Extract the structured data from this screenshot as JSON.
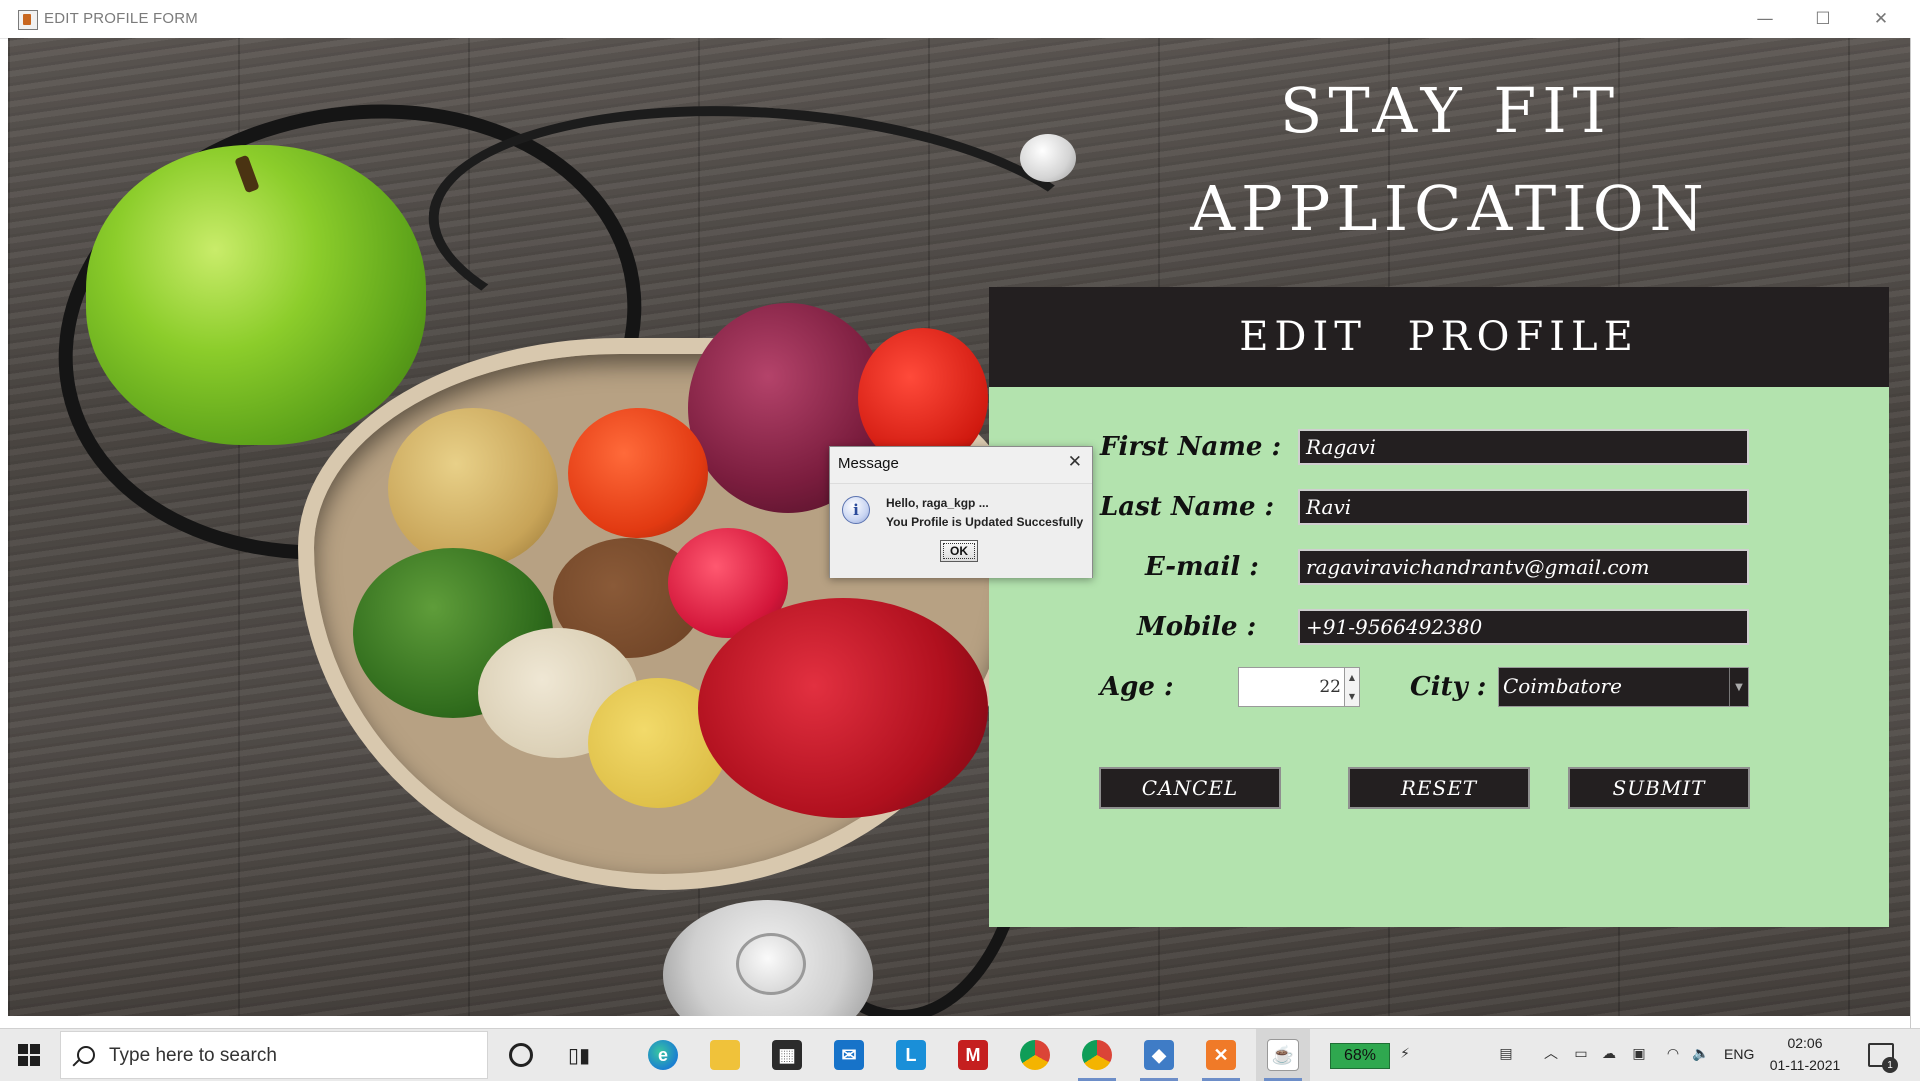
{
  "window": {
    "title": "EDIT PROFILE FORM",
    "controls": {
      "minimize": "—",
      "maximize": "☐",
      "close": "✕"
    }
  },
  "app": {
    "title_line1": "STAY FIT",
    "title_line2": "APPLICATION",
    "form_heading": "EDIT PROFILE"
  },
  "form": {
    "first_name": {
      "label": "First Name :",
      "value": "Ragavi"
    },
    "last_name": {
      "label": "Last Name :",
      "value": "Ravi"
    },
    "email": {
      "label": "E-mail :",
      "value": "ragaviravichandrantv@gmail.com"
    },
    "mobile": {
      "label": "Mobile :",
      "value": "+91-9566492380"
    },
    "age": {
      "label": "Age :",
      "value": "22"
    },
    "city": {
      "label": "City :",
      "value": "Coimbatore"
    },
    "buttons": {
      "cancel": "CANCEL",
      "reset": "RESET",
      "submit": "SUBMIT"
    }
  },
  "dialog": {
    "title": "Message",
    "line1": "Hello, raga_kgp ...",
    "line2": "You Profile is Updated Succesfully",
    "ok": "OK",
    "icon": "info-icon"
  },
  "taskbar": {
    "search_placeholder": "Type here to search",
    "battery": "68%",
    "language": "ENG",
    "time": "02:06",
    "date": "01-11-2021",
    "notification_count": "1"
  },
  "colors": {
    "panel_green": "#b3e3ae",
    "dark": "#231f20"
  }
}
